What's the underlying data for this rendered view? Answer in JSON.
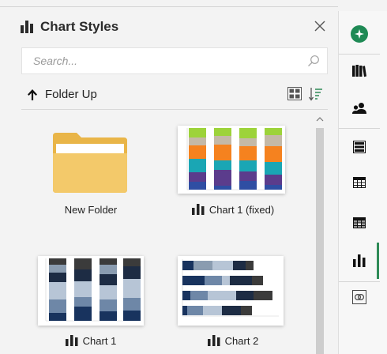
{
  "panel": {
    "title": "Chart Styles",
    "title_icon": "bar-chart-icon",
    "close_icon": "close-icon"
  },
  "search": {
    "placeholder": "Search...",
    "value": "",
    "icon": "search-icon"
  },
  "toolbar": {
    "folder_up_label": "Folder Up",
    "folder_up_icon": "arrow-up-icon",
    "view_icon": "grid-view-icon",
    "sort_icon": "sort-icon"
  },
  "tiles": [
    {
      "label": "New Folder",
      "kind": "folder"
    },
    {
      "label": "Chart  1 (fixed)",
      "kind": "chart"
    },
    {
      "label": "Chart 1",
      "kind": "chart"
    },
    {
      "label": "Chart 2",
      "kind": "chart"
    }
  ],
  "rail": {
    "items": [
      {
        "icon": "add-chart-icon"
      },
      {
        "icon": "library-icon"
      },
      {
        "icon": "users-icon"
      },
      {
        "icon": "film-icon"
      },
      {
        "icon": "table-icon"
      },
      {
        "icon": "table-dark-icon"
      },
      {
        "icon": "bar-chart-icon",
        "active": true
      },
      {
        "icon": "link-icon"
      }
    ]
  },
  "colors": {
    "accent": "#2e8b57",
    "folder": "#f3c96a",
    "panel_bg": "#f3f3f3"
  }
}
